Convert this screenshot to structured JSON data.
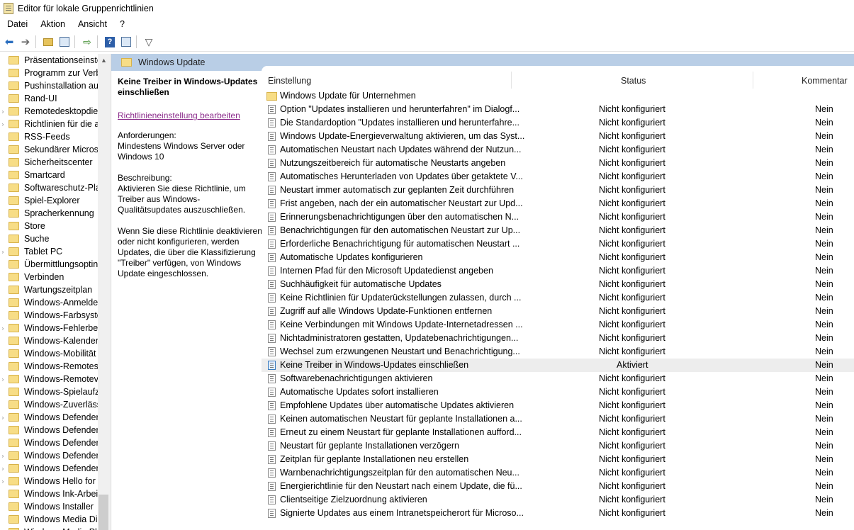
{
  "window": {
    "title": "Editor für lokale Gruppenrichtlinien",
    "icon": "policy-editor-icon"
  },
  "menu": [
    "Datei",
    "Aktion",
    "Ansicht",
    "?"
  ],
  "toolbar": {
    "buttons": [
      "back-arrow-icon",
      "forward-arrow-icon",
      "up-folder-icon",
      "show-hide-tree-icon",
      "export-list-icon",
      "help-icon",
      "properties-icon",
      "filter-icon"
    ]
  },
  "tree": {
    "items": [
      {
        "label": "Präsentationseinste",
        "expandable": false
      },
      {
        "label": "Programm zur Verb",
        "expandable": false
      },
      {
        "label": "Pushinstallation aus",
        "expandable": false
      },
      {
        "label": "Rand-UI",
        "expandable": false
      },
      {
        "label": "Remotedesktopdier",
        "expandable": true
      },
      {
        "label": "Richtlinien für die a",
        "expandable": true
      },
      {
        "label": "RSS-Feeds",
        "expandable": false
      },
      {
        "label": "Sekundärer Microsc",
        "expandable": false
      },
      {
        "label": "Sicherheitscenter",
        "expandable": false
      },
      {
        "label": "Smartcard",
        "expandable": false
      },
      {
        "label": "Softwareschutz-Plat",
        "expandable": false
      },
      {
        "label": "Spiel-Explorer",
        "expandable": false
      },
      {
        "label": "Spracherkennung",
        "expandable": false
      },
      {
        "label": "Store",
        "expandable": false
      },
      {
        "label": "Suche",
        "expandable": false
      },
      {
        "label": "Tablet PC",
        "expandable": true
      },
      {
        "label": "Übermittlungsoptin",
        "expandable": false
      },
      {
        "label": "Verbinden",
        "expandable": false
      },
      {
        "label": "Wartungszeitplan",
        "expandable": false
      },
      {
        "label": "Windows-Anmelde",
        "expandable": false
      },
      {
        "label": "Windows-Farbsyste",
        "expandable": false
      },
      {
        "label": "Windows-Fehlerber",
        "expandable": true
      },
      {
        "label": "Windows-Kalender",
        "expandable": false
      },
      {
        "label": "Windows-Mobilität",
        "expandable": false
      },
      {
        "label": "Windows-Remotesh",
        "expandable": false
      },
      {
        "label": "Windows-Remoteve",
        "expandable": true
      },
      {
        "label": "Windows-Spielaufze",
        "expandable": false
      },
      {
        "label": "Windows-Zuverläss",
        "expandable": false
      },
      {
        "label": "Windows Defender",
        "expandable": true
      },
      {
        "label": "Windows Defender",
        "expandable": false
      },
      {
        "label": "Windows Defender",
        "expandable": false
      },
      {
        "label": "Windows Defender",
        "expandable": true
      },
      {
        "label": "Windows Defender",
        "expandable": true
      },
      {
        "label": "Windows Hello for I",
        "expandable": true
      },
      {
        "label": "Windows Ink-Arbeit",
        "expandable": false
      },
      {
        "label": "Windows Installer",
        "expandable": false
      },
      {
        "label": "Windows Media Dig",
        "expandable": false
      },
      {
        "label": "Windows Media Pl",
        "expandable": false
      }
    ]
  },
  "header": {
    "title": "Windows Update"
  },
  "description": {
    "title": "Keine Treiber in Windows-Updates einschließen",
    "edit_link": "Richtlinieneinstellung bearbeiten",
    "requirements": "Anforderungen:\nMindestens Windows Server oder Windows 10",
    "description": "Beschreibung:\nAktivieren Sie diese Richtlinie, um Treiber aus Windows-Qualitätsupdates auszuschließen.",
    "details": "Wenn Sie diese Richtlinie deaktivieren oder nicht konfigurieren, werden Updates, die über die Klassifizierung \"Treiber\" verfügen, von Windows Update eingeschlossen."
  },
  "columns": {
    "setting": "Einstellung",
    "status": "Status",
    "comment": "Kommentar"
  },
  "rows": [
    {
      "name": "Windows Update für Unternehmen",
      "status": "",
      "comment": "",
      "type": "folder"
    },
    {
      "name": "Option \"Updates installieren und herunterfahren\" im Dialogf...",
      "status": "Nicht konfiguriert",
      "comment": "Nein",
      "type": "policy"
    },
    {
      "name": "Die Standardoption \"Updates installieren und herunterfahre...",
      "status": "Nicht konfiguriert",
      "comment": "Nein",
      "type": "policy"
    },
    {
      "name": "Windows Update-Energieverwaltung aktivieren, um das Syst...",
      "status": "Nicht konfiguriert",
      "comment": "Nein",
      "type": "policy"
    },
    {
      "name": "Automatischen Neustart nach Updates während der Nutzun...",
      "status": "Nicht konfiguriert",
      "comment": "Nein",
      "type": "policy"
    },
    {
      "name": "Nutzungszeitbereich für automatische Neustarts angeben",
      "status": "Nicht konfiguriert",
      "comment": "Nein",
      "type": "policy"
    },
    {
      "name": "Automatisches Herunterladen von Updates über getaktete V...",
      "status": "Nicht konfiguriert",
      "comment": "Nein",
      "type": "policy"
    },
    {
      "name": "Neustart immer automatisch zur geplanten Zeit durchführen",
      "status": "Nicht konfiguriert",
      "comment": "Nein",
      "type": "policy"
    },
    {
      "name": "Frist angeben, nach der ein automatischer Neustart zur Upd...",
      "status": "Nicht konfiguriert",
      "comment": "Nein",
      "type": "policy"
    },
    {
      "name": "Erinnerungsbenachrichtigungen über den automatischen N...",
      "status": "Nicht konfiguriert",
      "comment": "Nein",
      "type": "policy"
    },
    {
      "name": "Benachrichtigungen für den automatischen Neustart zur Up...",
      "status": "Nicht konfiguriert",
      "comment": "Nein",
      "type": "policy"
    },
    {
      "name": "Erforderliche Benachrichtigung für automatischen Neustart ...",
      "status": "Nicht konfiguriert",
      "comment": "Nein",
      "type": "policy"
    },
    {
      "name": "Automatische Updates konfigurieren",
      "status": "Nicht konfiguriert",
      "comment": "Nein",
      "type": "policy"
    },
    {
      "name": "Internen Pfad für den Microsoft Updatedienst angeben",
      "status": "Nicht konfiguriert",
      "comment": "Nein",
      "type": "policy"
    },
    {
      "name": "Suchhäufigkeit für automatische Updates",
      "status": "Nicht konfiguriert",
      "comment": "Nein",
      "type": "policy"
    },
    {
      "name": "Keine Richtlinien für Updaterückstellungen zulassen, durch ...",
      "status": "Nicht konfiguriert",
      "comment": "Nein",
      "type": "policy"
    },
    {
      "name": "Zugriff auf alle Windows Update-Funktionen entfernen",
      "status": "Nicht konfiguriert",
      "comment": "Nein",
      "type": "policy"
    },
    {
      "name": "Keine Verbindungen mit Windows Update-Internetadressen ...",
      "status": "Nicht konfiguriert",
      "comment": "Nein",
      "type": "policy"
    },
    {
      "name": "Nichtadministratoren gestatten, Updatebenachrichtigungen...",
      "status": "Nicht konfiguriert",
      "comment": "Nein",
      "type": "policy"
    },
    {
      "name": "Wechsel zum erzwungenen Neustart und Benachrichtigung...",
      "status": "Nicht konfiguriert",
      "comment": "Nein",
      "type": "policy"
    },
    {
      "name": "Keine Treiber in Windows-Updates einschließen",
      "status": "Aktiviert",
      "comment": "Nein",
      "type": "active",
      "selected": true
    },
    {
      "name": "Softwarebenachrichtigungen aktivieren",
      "status": "Nicht konfiguriert",
      "comment": "Nein",
      "type": "policy"
    },
    {
      "name": "Automatische Updates sofort installieren",
      "status": "Nicht konfiguriert",
      "comment": "Nein",
      "type": "policy"
    },
    {
      "name": "Empfohlene Updates über automatische Updates aktivieren",
      "status": "Nicht konfiguriert",
      "comment": "Nein",
      "type": "policy"
    },
    {
      "name": "Keinen automatischen Neustart für geplante Installationen a...",
      "status": "Nicht konfiguriert",
      "comment": "Nein",
      "type": "policy"
    },
    {
      "name": "Erneut zu einem Neustart für geplante Installationen aufford...",
      "status": "Nicht konfiguriert",
      "comment": "Nein",
      "type": "policy"
    },
    {
      "name": "Neustart für geplante Installationen verzögern",
      "status": "Nicht konfiguriert",
      "comment": "Nein",
      "type": "policy"
    },
    {
      "name": "Zeitplan für geplante Installationen neu erstellen",
      "status": "Nicht konfiguriert",
      "comment": "Nein",
      "type": "policy"
    },
    {
      "name": "Warnbenachrichtigungszeitplan für den automatischen Neu...",
      "status": "Nicht konfiguriert",
      "comment": "Nein",
      "type": "policy"
    },
    {
      "name": "Energierichtlinie für den Neustart nach einem Update, die fü...",
      "status": "Nicht konfiguriert",
      "comment": "Nein",
      "type": "policy"
    },
    {
      "name": "Clientseitige Zielzuordnung aktivieren",
      "status": "Nicht konfiguriert",
      "comment": "Nein",
      "type": "policy"
    },
    {
      "name": "Signierte Updates aus einem Intranetspeicherort für Microso...",
      "status": "Nicht konfiguriert",
      "comment": "Nein",
      "type": "policy"
    }
  ]
}
